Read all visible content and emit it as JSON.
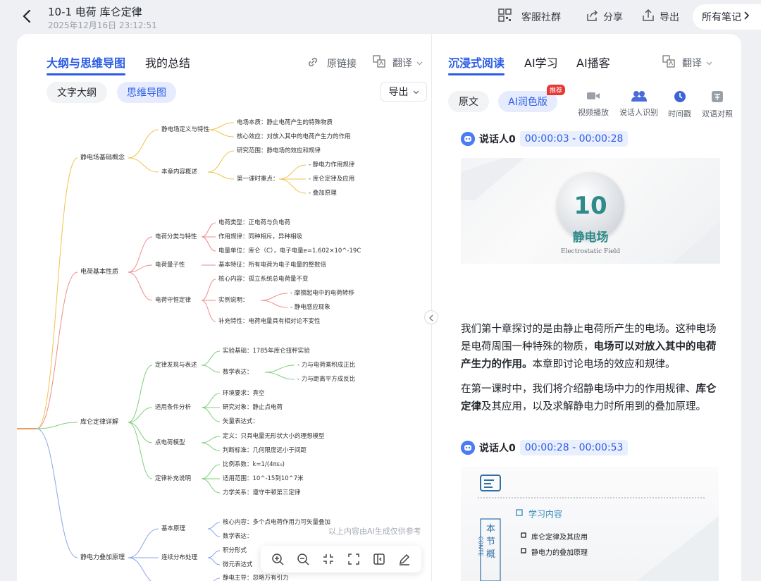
{
  "header": {
    "title": "10-1 电荷 库仑定律",
    "datetime": "2025年12月16日 23:12:51",
    "group_label": "客服社群",
    "share_label": "分享",
    "export_label": "导出",
    "all_notes_label": "所有笔记"
  },
  "left": {
    "tab_mindmap_outline": "大纲与思维导图",
    "tab_summary": "我的总结",
    "source_link": "原链接",
    "translate": "翻译",
    "pill_text_outline": "文字大纲",
    "pill_mindmap": "思维导图",
    "export": "导出",
    "watermark": "以上内容由AI生成仅供参考"
  },
  "mindmap": {
    "root_color": "#e07b2a",
    "branches": [
      {
        "label": "静电场基础概念",
        "color": "#f0c24a",
        "children": [
          {
            "label": "静电场定义与特性",
            "children": [
              {
                "label": "电场本质：静止电荷产生的特殊物质"
              },
              {
                "label": "核心效应：对放入其中的电荷产生力的作用"
              }
            ]
          },
          {
            "label": "本章内容概述",
            "children": [
              {
                "label": "研究范围：静电场的效应和规律"
              },
              {
                "label": "第一课时重点：",
                "children": [
                  {
                    "label": "- 静电力作用规律"
                  },
                  {
                    "label": "- 库仑定律及应用"
                  },
                  {
                    "label": "- 叠加原理"
                  }
                ]
              }
            ]
          }
        ]
      },
      {
        "label": "电荷基本性质",
        "color": "#ef8a8a",
        "children": [
          {
            "label": "电荷分类与特性",
            "children": [
              {
                "label": "电荷类型：正电荷与负电荷"
              },
              {
                "label": "作用规律：同种相斥，异种相吸"
              },
              {
                "label": "电量单位：库仑（C），电子电量e=1.602×10^-19C"
              }
            ]
          },
          {
            "label": "电荷量子性",
            "children": [
              {
                "label": "基本特征：所有电荷为电子电量的整数倍"
              }
            ]
          },
          {
            "label": "电荷守恒定律",
            "children": [
              {
                "label": "核心内容：孤立系统总电荷量不变"
              },
              {
                "label": "实例说明：",
                "children": [
                  {
                    "label": "- 摩擦起电中的电荷转移"
                  },
                  {
                    "label": "- 静电感应现象"
                  }
                ]
              },
              {
                "label": "补充特性：电荷电量具有相对论不变性"
              }
            ]
          }
        ]
      },
      {
        "label": "库仑定律详解",
        "color": "#7fcf7a",
        "children": [
          {
            "label": "定律发现与表述",
            "children": [
              {
                "label": "实验基础：1785年库仑扭秤实验"
              },
              {
                "label": "数学表达：",
                "children": [
                  {
                    "label": "- 力与电荷乘积成正比"
                  },
                  {
                    "label": "- 力与距离平方成反比"
                  }
                ]
              }
            ]
          },
          {
            "label": "适用条件分析",
            "children": [
              {
                "label": "环境要求：真空"
              },
              {
                "label": "研究对象：静止点电荷"
              },
              {
                "label": "矢量表达式："
              }
            ]
          },
          {
            "label": "点电荷模型",
            "children": [
              {
                "label": "定义：只具电量无形状大小的理想模型"
              },
              {
                "label": "判断标准：几何限度远小于间距"
              }
            ]
          },
          {
            "label": "定律补充说明",
            "children": [
              {
                "label": "比例系数：k=1/(4πε₀)"
              },
              {
                "label": "适用范围：10^-15到10^7米"
              },
              {
                "label": "力学关系：遵守牛顿第三定律"
              }
            ]
          }
        ]
      },
      {
        "label": "静电力叠加原理",
        "color": "#8aa6ea",
        "children": [
          {
            "label": "基本原理",
            "children": [
              {
                "label": "核心内容：多个点电荷作用力可矢量叠加"
              },
              {
                "label": "数学表达："
              }
            ]
          },
          {
            "label": "连续分布处理",
            "children": [
              {
                "label": "积分形式"
              },
              {
                "label": "微元表达式"
              }
            ]
          },
          {
            "label": "",
            "children": [
              {
                "label": "静电主导：忽略万有引力"
              }
            ]
          }
        ]
      }
    ]
  },
  "right": {
    "tab_immersive": "沉浸式阅读",
    "tab_ai_learn": "AI学习",
    "tab_ai_broadcast": "AI播客",
    "translate": "翻译",
    "pill_original": "原文",
    "pill_ai_polish": "AI润色版",
    "badge_recommend": "推荐",
    "tools": [
      {
        "label": "视频播放"
      },
      {
        "label": "说话人识别"
      },
      {
        "label": "时间戳"
      },
      {
        "label": "双语对照"
      }
    ],
    "segment1": {
      "speaker": "说话人0",
      "time": "00:00:03 - 00:00:28",
      "slide_number": "10",
      "slide_title": "静电场",
      "slide_subtitle": "Electrostatic Field",
      "p1_a": "我们第十章探讨的是由静止电荷所产生的电场。这种电场是电荷周围一种特殊的物质，",
      "p1_b": "电场可以对放入其中的电荷产生力的作用。",
      "p1_c": "本章即讨论电场的效应和规律。",
      "p2_a": "在第一课时中，我们将介绍静电场中力的作用规律、",
      "p2_b": "库仑定律",
      "p2_c": "及其应用，以及求解静电力时所用到的叠加原理。"
    },
    "segment2": {
      "speaker": "说话人0",
      "time": "00:00:28 - 00:00:53",
      "slide_heading": "学习内容",
      "slide_side": "本节概",
      "slide_side_en": "CONTE",
      "slide_items": [
        "库仑定律及其应用",
        "静电力的叠加原理"
      ]
    }
  }
}
